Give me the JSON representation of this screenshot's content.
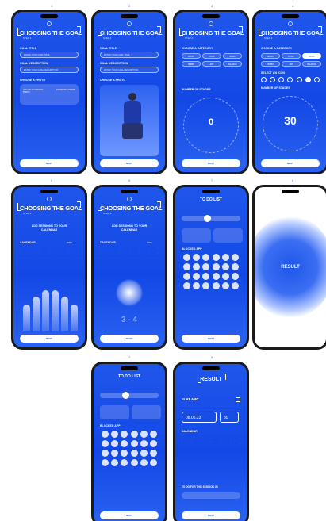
{
  "frame_numbers": [
    "1",
    "2",
    "3",
    "4",
    "5",
    "6",
    "7",
    "8",
    "7",
    "8"
  ],
  "common": {
    "title": "CHOOSING THE GOAL",
    "next": "NEXT"
  },
  "s1": {
    "step": "STEP 1",
    "goal_title_label": "GOAL TITLE",
    "goal_title_value": "ENTER YOUR GOAL TITLE",
    "goal_desc_label": "GOAL DESCRIPTION",
    "goal_desc_value": "ENTER YOUR GOAL DESCRIPTION",
    "photo_label": "CHOOSE A PHOTO",
    "photo_left": "UPLOAD AN ORIGINAL PHOTO",
    "photo_right": "GENERATE A PHOTO"
  },
  "s2": {
    "step": "STEP 1",
    "goal_title_label": "GOAL TITLE",
    "goal_title_value": "ENTER YOUR GOAL TITLE",
    "goal_desc_label": "GOAL DESCRIPTION",
    "goal_desc_value": "ENTER YOUR GOAL DESCRIPTION",
    "photo_label": "CHOOSE A PHOTO"
  },
  "s3": {
    "step": "STEP 2",
    "category_label": "CHOOSE A CATEGORY",
    "chips": [
      "SPORT",
      "STUDY",
      "WORK",
      "HOBBY",
      "ART",
      "BALANCE"
    ],
    "stages_label": "NUMBER OF STAGES",
    "stages_value": "0"
  },
  "s4": {
    "step": "STEP 2",
    "category_label": "CHOOSE A CATEGORY",
    "chips": [
      "SPORT",
      "STUDY",
      "WORK",
      "HOBBY",
      "ART",
      "BALANCE"
    ],
    "icon_label": "SELECT AN ICON",
    "stages_label": "NUMBER OF STAGES",
    "stages_value": "30"
  },
  "s5": {
    "step": "STEP 3",
    "heading": "ADD SESSIONS TO YOUR CALENDAR",
    "calendar_label": "CALENDAR",
    "month": "JUNE"
  },
  "s6": {
    "step": "STEP 3",
    "heading": "ADD SESSIONS TO YOUR CALENDAR",
    "calendar_label": "CALENDAR",
    "month": "JUNE",
    "counter": "3 - 4"
  },
  "s7": {
    "title": "TO DO LIST",
    "blocked": "BLOCKED APP"
  },
  "s8": {
    "result": "RESULT"
  },
  "s9": {
    "title": "TO DO LIST",
    "blocked": "BLOCKED APP"
  },
  "s10": {
    "title": "RESULT",
    "goal_name": "FLAT ABC",
    "date": "08.06.23",
    "num": "30",
    "calendar_label": "CALENDAR",
    "todo_label": "TO DO FOR THIS SESSION (3)"
  }
}
